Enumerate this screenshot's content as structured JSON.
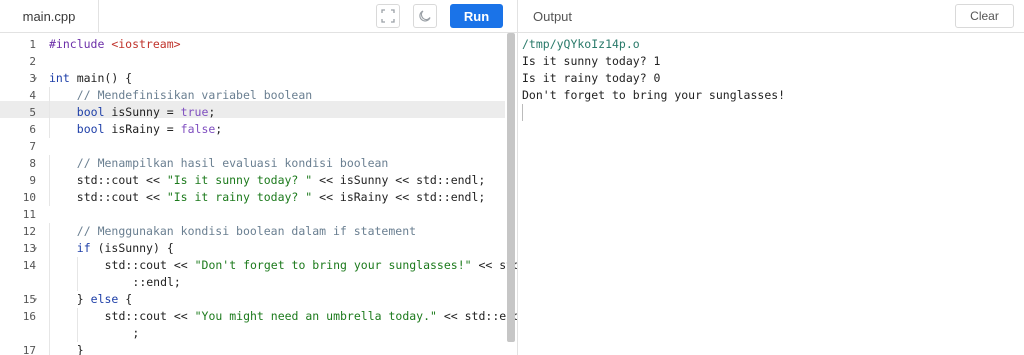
{
  "header": {
    "file_tab": "main.cpp",
    "run_label": "Run",
    "output_title": "Output",
    "clear_label": "Clear"
  },
  "editor": {
    "lines": [
      {
        "num": "1",
        "fold": "",
        "indent": 0,
        "tokens": [
          {
            "t": "#include ",
            "c": "pp"
          },
          {
            "t": "<iostream>",
            "c": "inc"
          }
        ]
      },
      {
        "num": "2",
        "fold": "",
        "indent": 0,
        "tokens": []
      },
      {
        "num": "3",
        "fold": "▾",
        "indent": 0,
        "tokens": [
          {
            "t": "int",
            "c": "kw"
          },
          {
            "t": " main() {",
            "c": "txt"
          }
        ]
      },
      {
        "num": "4",
        "fold": "",
        "indent": 1,
        "tokens": [
          {
            "t": "// Mendefinisikan variabel boolean",
            "c": "cm"
          }
        ]
      },
      {
        "num": "5",
        "fold": "",
        "indent": 1,
        "tokens": [
          {
            "t": "bool",
            "c": "kw"
          },
          {
            "t": " isSunny = ",
            "c": "txt"
          },
          {
            "t": "true",
            "c": "lit"
          },
          {
            "t": ";",
            "c": "txt"
          }
        ]
      },
      {
        "num": "6",
        "fold": "",
        "indent": 1,
        "tokens": [
          {
            "t": "bool",
            "c": "kw"
          },
          {
            "t": " isRainy = ",
            "c": "txt"
          },
          {
            "t": "false",
            "c": "lit"
          },
          {
            "t": ";",
            "c": "txt"
          }
        ]
      },
      {
        "num": "7",
        "fold": "",
        "indent": 0,
        "tokens": []
      },
      {
        "num": "8",
        "fold": "",
        "indent": 1,
        "tokens": [
          {
            "t": "// Menampilkan hasil evaluasi kondisi boolean",
            "c": "cm"
          }
        ]
      },
      {
        "num": "9",
        "fold": "",
        "indent": 1,
        "tokens": [
          {
            "t": "std::cout << ",
            "c": "txt"
          },
          {
            "t": "\"Is it sunny today? \"",
            "c": "str"
          },
          {
            "t": " << isSunny << std::endl;",
            "c": "txt"
          }
        ]
      },
      {
        "num": "10",
        "fold": "",
        "indent": 1,
        "tokens": [
          {
            "t": "std::cout << ",
            "c": "txt"
          },
          {
            "t": "\"Is it rainy today? \"",
            "c": "str"
          },
          {
            "t": " << isRainy << std::endl;",
            "c": "txt"
          }
        ]
      },
      {
        "num": "11",
        "fold": "",
        "indent": 0,
        "tokens": []
      },
      {
        "num": "12",
        "fold": "",
        "indent": 1,
        "tokens": [
          {
            "t": "// Menggunakan kondisi boolean dalam if statement",
            "c": "cm"
          }
        ]
      },
      {
        "num": "13",
        "fold": "▾",
        "indent": 1,
        "tokens": [
          {
            "t": "if",
            "c": "kw"
          },
          {
            "t": " (isSunny) {",
            "c": "txt"
          }
        ]
      },
      {
        "num": "14",
        "fold": "",
        "indent": 2,
        "tokens": [
          {
            "t": "std::cout << ",
            "c": "txt"
          },
          {
            "t": "\"Don't forget to bring your sunglasses!\"",
            "c": "str"
          },
          {
            "t": " << std",
            "c": "txt"
          }
        ]
      },
      {
        "num": "",
        "fold": "",
        "indent": 3,
        "tokens": [
          {
            "t": "::endl;",
            "c": "txt"
          }
        ]
      },
      {
        "num": "15",
        "fold": "▾",
        "indent": 1,
        "tokens": [
          {
            "t": "} ",
            "c": "txt"
          },
          {
            "t": "else",
            "c": "kw"
          },
          {
            "t": " {",
            "c": "txt"
          }
        ]
      },
      {
        "num": "16",
        "fold": "",
        "indent": 2,
        "tokens": [
          {
            "t": "std::cout << ",
            "c": "txt"
          },
          {
            "t": "\"You might need an umbrella today.\"",
            "c": "str"
          },
          {
            "t": " << std::endl",
            "c": "txt"
          }
        ]
      },
      {
        "num": "",
        "fold": "",
        "indent": 3,
        "tokens": [
          {
            "t": ";",
            "c": "txt"
          }
        ]
      },
      {
        "num": "17",
        "fold": "",
        "indent": 1,
        "tokens": [
          {
            "t": "}",
            "c": "txt"
          }
        ]
      }
    ]
  },
  "output": {
    "path": "/tmp/yQYkoIz14p.o",
    "lines": [
      "Is it sunny today? 1",
      "Is it rainy today? 0",
      "Don't forget to bring your sunglasses!"
    ]
  },
  "icons": {
    "fullscreen": "fullscreen-icon",
    "theme": "moon-icon"
  }
}
